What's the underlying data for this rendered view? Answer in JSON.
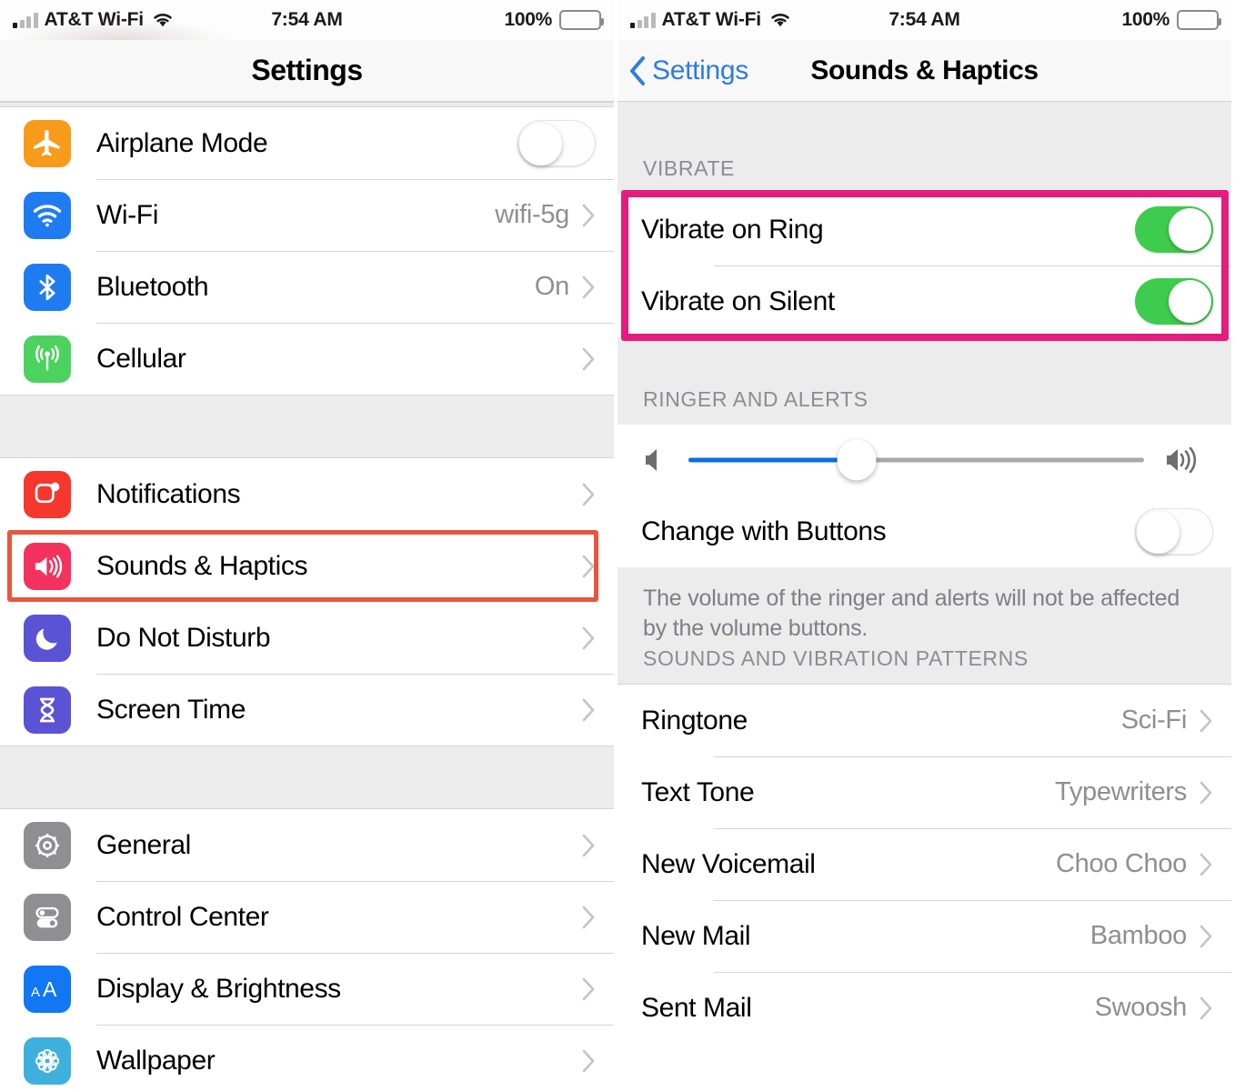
{
  "status_bar": {
    "carrier": "AT&T Wi-Fi",
    "time": "7:54 AM",
    "battery_percent": "100%",
    "signal_icon": "signal-bars-icon",
    "wifi_icon": "wifi-icon",
    "battery_icon": "battery-full-icon"
  },
  "left_screen": {
    "title": "Settings",
    "groups": [
      {
        "rows": [
          {
            "label": "Airplane Mode",
            "icon": "airplane-icon",
            "icon_color": "#f79b1b",
            "control": "toggle-off"
          },
          {
            "label": "Wi-Fi",
            "icon": "wifi-icon",
            "icon_color": "#1f7bf0",
            "value": "wifi-5g",
            "control": "chevron"
          },
          {
            "label": "Bluetooth",
            "icon": "bluetooth-icon",
            "icon_color": "#1f7bf0",
            "value": "On",
            "control": "chevron"
          },
          {
            "label": "Cellular",
            "icon": "cellular-antenna-icon",
            "icon_color": "#4cd25f",
            "value": "",
            "control": "chevron"
          }
        ]
      },
      {
        "rows": [
          {
            "label": "Notifications",
            "icon": "notifications-icon",
            "icon_color": "#f5372e",
            "value": "",
            "control": "chevron"
          },
          {
            "label": "Sounds & Haptics",
            "icon": "speaker-icon",
            "icon_color": "#f3325d",
            "value": "",
            "control": "chevron",
            "highlighted": true
          },
          {
            "label": "Do Not Disturb",
            "icon": "moon-icon",
            "icon_color": "#5a53d6",
            "value": "",
            "control": "chevron"
          },
          {
            "label": "Screen Time",
            "icon": "hourglass-icon",
            "icon_color": "#5a53d6",
            "value": "",
            "control": "chevron"
          }
        ]
      },
      {
        "rows": [
          {
            "label": "General",
            "icon": "gear-icon",
            "icon_color": "#8e8e93",
            "value": "",
            "control": "chevron"
          },
          {
            "label": "Control Center",
            "icon": "control-center-icon",
            "icon_color": "#8e8e93",
            "value": "",
            "control": "chevron"
          },
          {
            "label": "Display & Brightness",
            "icon": "text-size-icon",
            "icon_color": "#1277f2",
            "value": "",
            "control": "chevron"
          },
          {
            "label": "Wallpaper",
            "icon": "wallpaper-flower-icon",
            "icon_color": "#3fb0dd",
            "value": "",
            "control": "chevron"
          }
        ]
      }
    ],
    "highlight_color": "#e8563f"
  },
  "right_screen": {
    "back_label": "Settings",
    "title": "Sounds & Haptics",
    "back_icon": "chevron-left-icon",
    "accent_color": "#2d7ce0",
    "highlight_color": "#e51b7e",
    "sections": [
      {
        "header": "VIBRATE",
        "rows": [
          {
            "label": "Vibrate on Ring",
            "control": "toggle-on"
          },
          {
            "label": "Vibrate on Silent",
            "control": "toggle-on"
          }
        ]
      },
      {
        "header": "RINGER AND ALERTS",
        "slider": {
          "value_percent": 37,
          "left_icon": "speaker-low-icon",
          "right_icon": "speaker-high-icon",
          "fill_color": "#0a6fe0"
        },
        "rows": [
          {
            "label": "Change with Buttons",
            "control": "toggle-off"
          }
        ],
        "footnote": "The volume of the ringer and alerts will not be affected by the volume buttons."
      },
      {
        "header": "SOUNDS AND VIBRATION PATTERNS",
        "rows": [
          {
            "label": "Ringtone",
            "value": "Sci-Fi",
            "control": "chevron"
          },
          {
            "label": "Text Tone",
            "value": "Typewriters",
            "control": "chevron"
          },
          {
            "label": "New Voicemail",
            "value": "Choo Choo",
            "control": "chevron"
          },
          {
            "label": "New Mail",
            "value": "Bamboo",
            "control": "chevron"
          },
          {
            "label": "Sent Mail",
            "value": "Swoosh",
            "control": "chevron"
          }
        ]
      }
    ],
    "toggle_on_color": "#3ecc4e"
  }
}
